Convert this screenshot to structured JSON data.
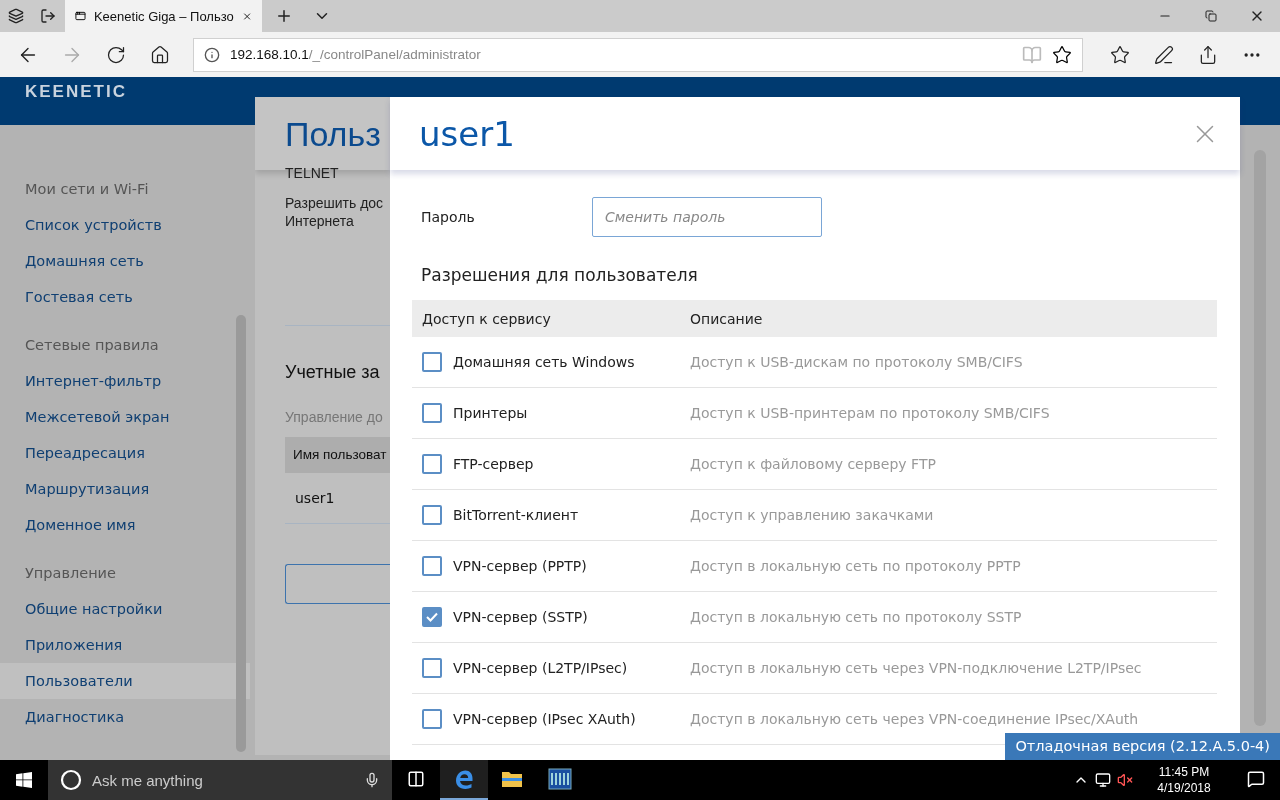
{
  "browser": {
    "tabs": [
      {
        "title": "Keenetic Giga – Пользо",
        "selected": true
      }
    ],
    "url": {
      "host": "192.168.10.1",
      "path": "/_/controlPanel/administrator"
    }
  },
  "logo": "KEENETIC",
  "sidebar": {
    "groups": [
      {
        "title": "Мои сети и Wi-Fi",
        "items": [
          {
            "label": "Список устройств",
            "selected": false
          },
          {
            "label": "Домашняя сеть",
            "selected": false
          },
          {
            "label": "Гостевая сеть",
            "selected": false
          }
        ]
      },
      {
        "title": "Сетевые правила",
        "items": [
          {
            "label": "Интернет-фильтр",
            "selected": false
          },
          {
            "label": "Межсетевой экран",
            "selected": false
          },
          {
            "label": "Переадресация",
            "selected": false
          },
          {
            "label": "Маршрутизация",
            "selected": false
          },
          {
            "label": "Доменное имя",
            "selected": false
          }
        ]
      },
      {
        "title": "Управление",
        "items": [
          {
            "label": "Общие настройки",
            "selected": false
          },
          {
            "label": "Приложения",
            "selected": false
          },
          {
            "label": "Пользователи",
            "selected": true
          },
          {
            "label": "Диагностика",
            "selected": false
          }
        ]
      }
    ]
  },
  "main": {
    "title": "Польз",
    "telnet": "TELNET",
    "allow_lines": [
      "Разрешить дос",
      "Интернета"
    ],
    "accounts_title": "Учетные за",
    "accounts_hint": "Управление до",
    "table_header": "Имя пользоват",
    "rows": [
      "user1"
    ]
  },
  "modal": {
    "title": "user1",
    "password": {
      "label": "Пароль",
      "placeholder": "Сменить пароль"
    },
    "permissions_title": "Разрешения для пользователя",
    "columns": [
      "Доступ к сервису",
      "Описание"
    ],
    "rows": [
      {
        "service": "Домашняя сеть Windows",
        "description": "Доступ к USB-дискам по протоколу SMB/CIFS",
        "checked": false
      },
      {
        "service": "Принтеры",
        "description": "Доступ к USB-принтерам по протоколу SMB/CIFS",
        "checked": false
      },
      {
        "service": "FTP-сервер",
        "description": "Доступ к файловому серверу FTP",
        "checked": false
      },
      {
        "service": "BitTorrent-клиент",
        "description": "Доступ к управлению закачками",
        "checked": false
      },
      {
        "service": "VPN-сервер (PPTP)",
        "description": "Доступ в локальную сеть по протоколу PPTP",
        "checked": false
      },
      {
        "service": "VPN-сервер (SSTP)",
        "description": "Доступ в локальную сеть по протоколу SSTP",
        "checked": true
      },
      {
        "service": "VPN-сервер (L2TP/IPsec)",
        "description": "Доступ в локальную сеть через VPN-подключение L2TP/IPsec",
        "checked": false
      },
      {
        "service": "VPN-сервер (IPsec XAuth)",
        "description": "Доступ в локальную сеть через VPN-соединение IPsec/XAuth",
        "checked": false
      }
    ]
  },
  "debug_badge": "Отладочная версия (2.12.A.5.0-4)",
  "taskbar": {
    "search_placeholder": "Ask me anything",
    "time": "11:45 PM",
    "date": "4/19/2018"
  }
}
